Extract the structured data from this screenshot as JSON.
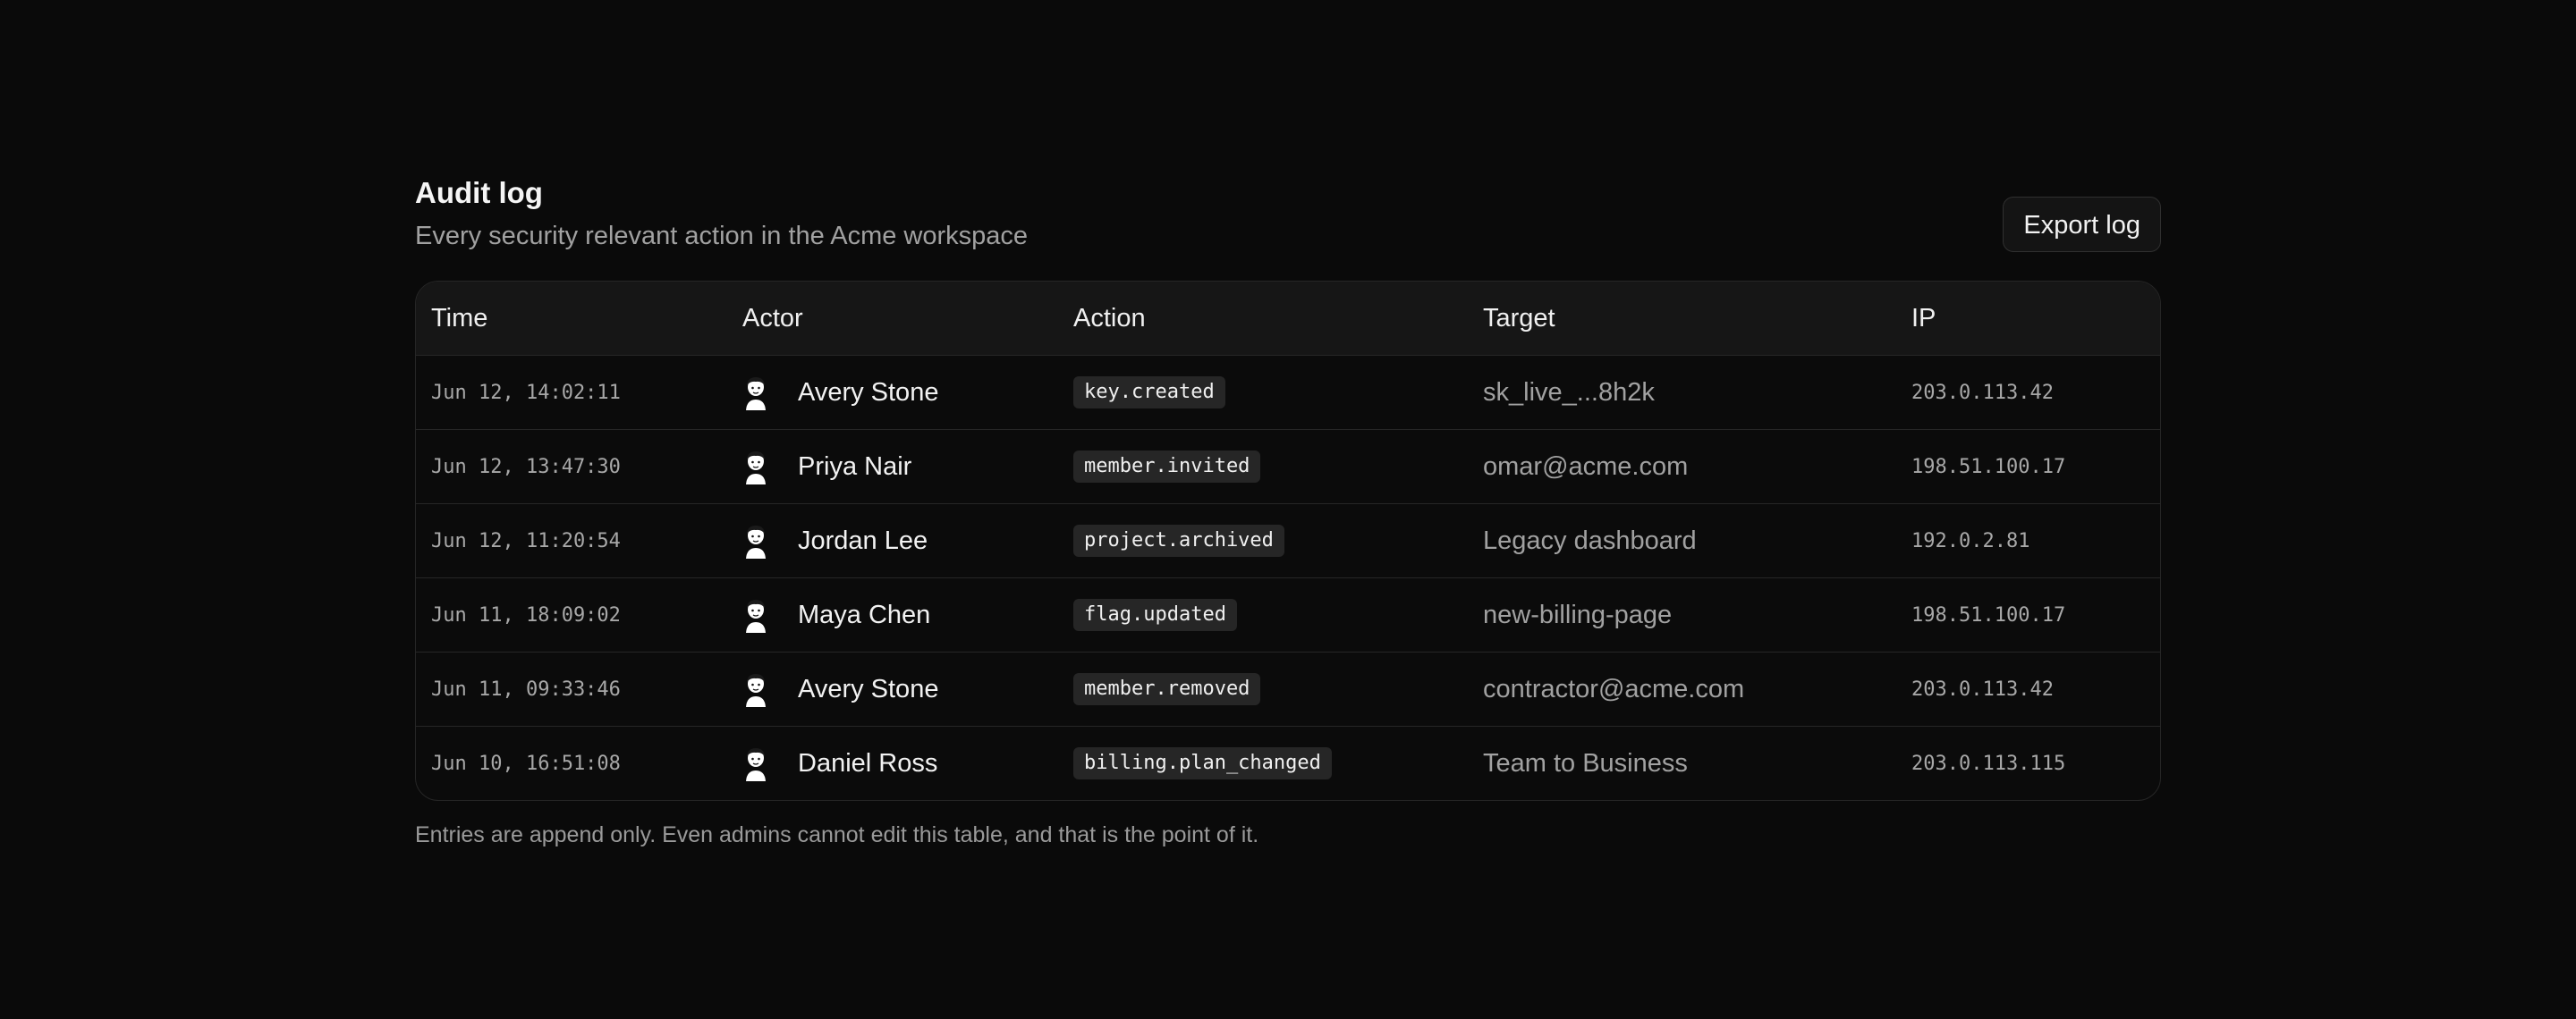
{
  "header": {
    "title": "Audit log",
    "subtitle": "Every security relevant action in the Acme workspace",
    "export_label": "Export log"
  },
  "table": {
    "columns": [
      "Time",
      "Actor",
      "Action",
      "Target",
      "IP"
    ],
    "rows": [
      {
        "time": "Jun 12, 14:02:11",
        "actor": "Avery Stone",
        "action": "key.created",
        "target": "sk_live_...8h2k",
        "ip": "203.0.113.42"
      },
      {
        "time": "Jun 12, 13:47:30",
        "actor": "Priya Nair",
        "action": "member.invited",
        "target": "omar@acme.com",
        "ip": "198.51.100.17"
      },
      {
        "time": "Jun 12, 11:20:54",
        "actor": "Jordan Lee",
        "action": "project.archived",
        "target": "Legacy dashboard",
        "ip": "192.0.2.81"
      },
      {
        "time": "Jun 11, 18:09:02",
        "actor": "Maya Chen",
        "action": "flag.updated",
        "target": "new-billing-page",
        "ip": "198.51.100.17"
      },
      {
        "time": "Jun 11, 09:33:46",
        "actor": "Avery Stone",
        "action": "member.removed",
        "target": "contractor@acme.com",
        "ip": "203.0.113.42"
      },
      {
        "time": "Jun 10, 16:51:08",
        "actor": "Daniel Ross",
        "action": "billing.plan_changed",
        "target": "Team to Business",
        "ip": "203.0.113.115"
      }
    ]
  },
  "footnote": "Entries are append only. Even admins cannot edit this table, and that is the point of it.",
  "icons": {
    "avatar": "avatar-icon"
  },
  "colors": {
    "background": "#0a0a0a",
    "header_row": "#161616",
    "badge": "#262626",
    "border": "#262626"
  }
}
